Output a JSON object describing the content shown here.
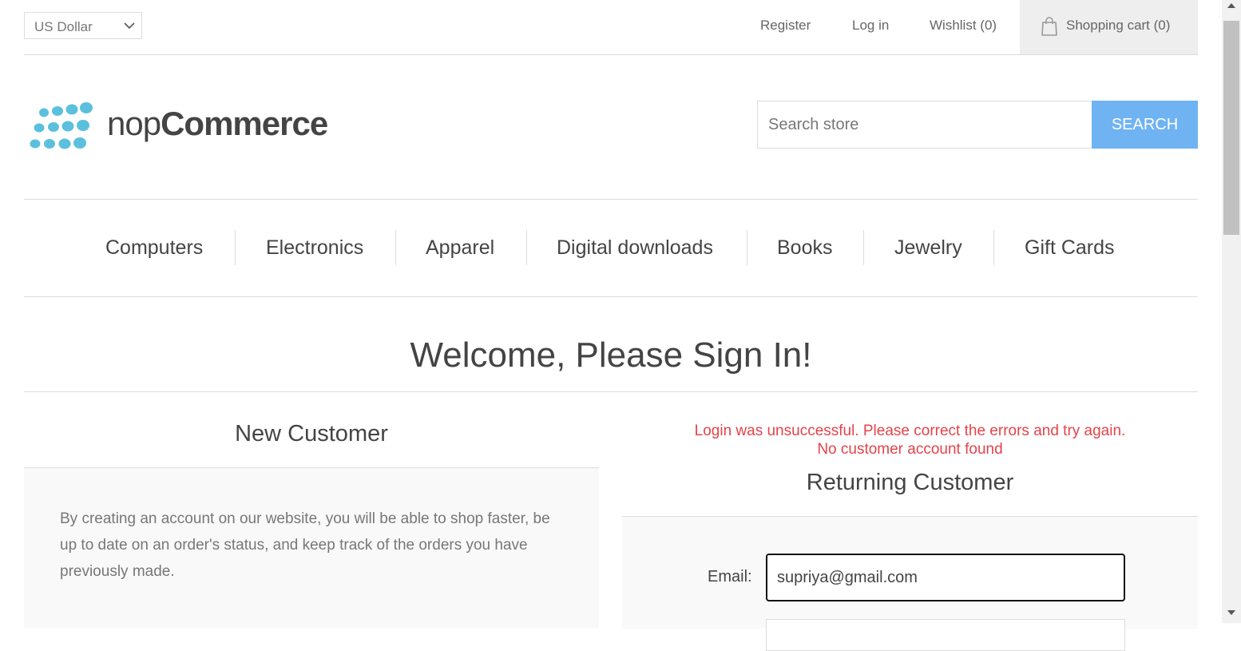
{
  "header": {
    "currency": {
      "selected": "US Dollar"
    },
    "links": {
      "register": "Register",
      "login": "Log in",
      "wishlist": "Wishlist (0)",
      "cart": "Shopping cart (0)"
    }
  },
  "logo": {
    "light": "nop",
    "bold": "Commerce",
    "dot_color": "#5bc0de"
  },
  "search": {
    "placeholder": "Search store",
    "button": "SEARCH",
    "button_color": "#6fb3f2"
  },
  "menu": {
    "items": [
      "Computers",
      "Electronics",
      "Apparel",
      "Digital downloads",
      "Books",
      "Jewelry",
      "Gift Cards"
    ]
  },
  "page": {
    "title": "Welcome, Please Sign In!"
  },
  "new_customer": {
    "title": "New Customer",
    "text": "By creating an account on our website, you will be able to shop faster, be up to date on an order's status, and keep track of the orders you have previously made."
  },
  "returning_customer": {
    "error_line1": "Login was unsuccessful. Please correct the errors and try again.",
    "error_line2": "No customer account found",
    "error_color": "#e4434b",
    "title": "Returning Customer",
    "email_label": "Email:",
    "email_value": "supriya@gmail.com"
  }
}
